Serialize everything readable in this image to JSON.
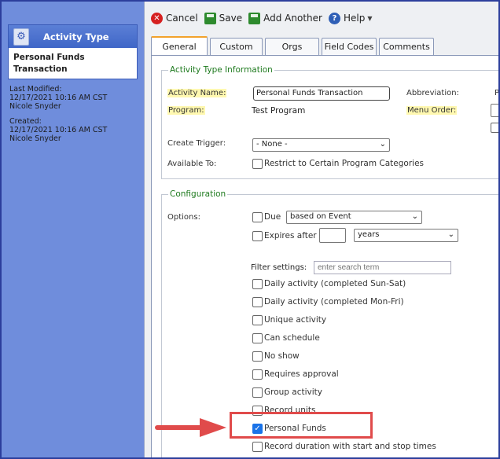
{
  "sidebar": {
    "card_title": "Activity Type",
    "record_name": "Personal Funds Transaction",
    "last_modified_label": "Last Modified:",
    "last_modified_date": "12/17/2021 10:16 AM CST",
    "last_modified_by": "Nicole Snyder",
    "created_label": "Created:",
    "created_date": "12/17/2021 10:16 AM CST",
    "created_by": "Nicole Snyder"
  },
  "toolbar": {
    "cancel_label": "Cancel",
    "save_label": "Save",
    "add_another_label": "Add Another",
    "help_label": "Help"
  },
  "tabs": [
    "General",
    "Custom",
    "Orgs",
    "Field Codes",
    "Comments"
  ],
  "info_section": {
    "legend": "Activity Type Information",
    "activity_name_label": "Activity Name:",
    "activity_name_value": "Personal Funds Transaction",
    "abbreviation_label": "Abbreviation:",
    "program_label": "Program:",
    "program_value": "Test Program",
    "menu_order_label": "Menu Order:",
    "create_trigger_label": "Create Trigger:",
    "create_trigger_value": "- None -",
    "available_to_label": "Available To:",
    "restrict_label": "Restrict to Certain Program Categories",
    "abbr_fragment": "P"
  },
  "config_section": {
    "legend": "Configuration",
    "options_label": "Options:",
    "due_label": "Due",
    "due_select_value": "based on Event",
    "expires_label": "Expires after",
    "expires_unit_value": "years",
    "filter_label": "Filter settings:",
    "filter_placeholder": "enter search term",
    "options": [
      {
        "label": "Daily activity (completed Sun-Sat)",
        "checked": false
      },
      {
        "label": "Daily activity (completed Mon-Fri)",
        "checked": false
      },
      {
        "label": "Unique activity",
        "checked": false
      },
      {
        "label": "Can schedule",
        "checked": false
      },
      {
        "label": "No show",
        "checked": false
      },
      {
        "label": "Requires approval",
        "checked": false
      },
      {
        "label": "Group activity",
        "checked": false
      },
      {
        "label": "Record units",
        "checked": false
      },
      {
        "label": "Personal Funds",
        "checked": true
      },
      {
        "label": "Record duration with start and stop times",
        "checked": false
      }
    ]
  },
  "colors": {
    "sidebar_bg": "#6f8ddc",
    "legend_green": "#1e7a1e",
    "highlight_red": "#e04b4b",
    "checked_blue": "#1a73e8"
  }
}
